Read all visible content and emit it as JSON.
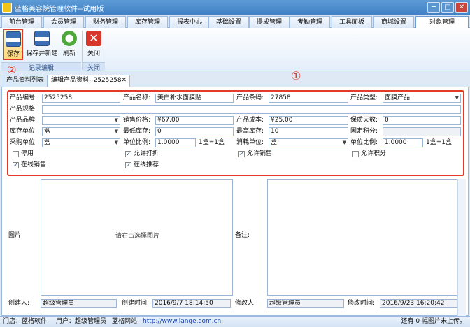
{
  "title_bar": {
    "title": "蓝格美容院管理软件--试用版",
    "minimize": "─",
    "maximize": "□",
    "close": "✕"
  },
  "menu_tabs": [
    "前台管理",
    "会员管理",
    "财务管理",
    "库存管理",
    "报表中心",
    "基础设置",
    "提成管理",
    "考勤管理",
    "工具面板",
    "商城设置",
    "对象管理"
  ],
  "active_menu_tab": "对象管理",
  "ribbon": {
    "save_label": "保存",
    "save_new_label": "保存并新建",
    "refresh_label": "刷新",
    "close_label": "关闭",
    "group_record_edit": "记录编辑",
    "group_close": "关闭",
    "marker_2": "②"
  },
  "doc_tabs": {
    "list_label": "产品资料列表",
    "edit_label": "编辑产品资料--2525258",
    "close_icon": "✕"
  },
  "marker_1": "①",
  "form": {
    "product_no_label": "产品编号:",
    "product_no": "2525258",
    "product_name_label": "产品名称:",
    "product_name": "美白补水面膜贴",
    "barcode_label": "产品条码:",
    "barcode": "27858",
    "type_label": "产品类型:",
    "type": "面膜产品",
    "spec_label": "产品规格:",
    "spec": "",
    "brand_label": "产品品牌:",
    "brand": "",
    "price_label": "销售价格:",
    "price": "¥67.00",
    "cost_label": "产品成本:",
    "cost": "¥25.00",
    "shelf_days_label": "保质天数:",
    "shelf_days": "0",
    "stock_unit_label": "库存单位:",
    "stock_unit": "盒",
    "min_stock_label": "最低库存:",
    "min_stock": "0",
    "max_stock_label": "最高库存:",
    "max_stock": "10",
    "fixed_points_label": "固定积分:",
    "fixed_points": "",
    "purchase_unit_label": "采购单位:",
    "purchase_unit": "盒",
    "ratio1_label": "单位比例:",
    "ratio1": "1.0000",
    "ratio1_text": "1盒=1盒",
    "consume_unit_label": "消耗单位:",
    "consume_unit": "盒",
    "ratio2_label": "单位比例:",
    "ratio2": "1.0000",
    "ratio2_text": "1盒=1盒",
    "disabled_label": "停用",
    "disabled_checked": false,
    "allow_discount_label": "允许打折",
    "allow_discount_checked": true,
    "allow_sale_label": "允许销售",
    "allow_sale_checked": true,
    "allow_points_label": "允许积分",
    "allow_points_checked": false,
    "online_sale_label": "在线销售",
    "online_sale_checked": true,
    "online_recommend_label": "在线推荐",
    "online_recommend_checked": true
  },
  "image_label": "图片:",
  "image_hint": "请右击选择图片",
  "remark_label": "备注:",
  "footer": {
    "creator_label": "创建人:",
    "creator": "超级管理员",
    "create_time_label": "创建时间:",
    "create_time": "2016/9/7 18:14:50",
    "modifier_label": "修改人:",
    "modifier": "超级管理员",
    "modify_time_label": "修改时间:",
    "modify_time": "2016/9/23 16:20:42"
  },
  "status_bar": {
    "store": "门店：蓝格软件",
    "user": "用户：超级管理员",
    "site_label": "蓝格网站:",
    "site_url": "http://www.lange.com.cn",
    "upload_status": "还有 0 幅图片未上传。"
  },
  "colors": {
    "accent_red": "#e23b2b",
    "title_blue": "#3f7fc4",
    "link": "#1a3fb0"
  },
  "icons": {
    "save": "floppy-disk-icon",
    "save_new": "floppy-plus-icon",
    "refresh": "refresh-icon",
    "close": "red-x-icon"
  }
}
